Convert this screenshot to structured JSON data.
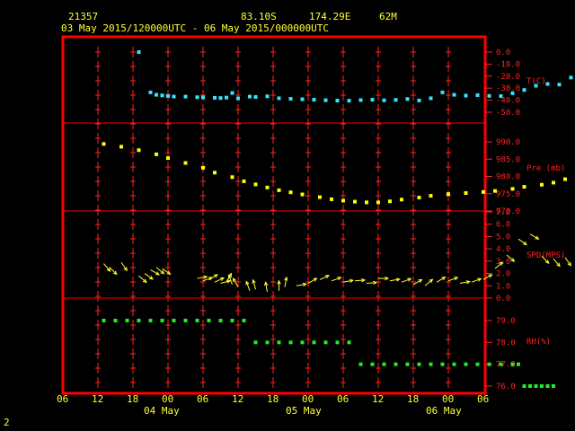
{
  "header": {
    "station": "21357",
    "latitude": "83.10S",
    "longitude": "174.29E",
    "elevation": "62M",
    "period": "03 May 2015/120000UTC - 06 May 2015/000000UTC"
  },
  "corner_label": "2",
  "colors": {
    "frame": "#ff0000",
    "text": "#ffff33",
    "temperature": "#33e6ff",
    "pressure": "#ffff00",
    "wind": "#ffff33",
    "humidity": "#22ee22"
  },
  "chart_data": {
    "type": "scatter",
    "x_unit": "hours since 03 May 2015 06 UTC",
    "x_ticks": [
      "06",
      "12",
      "18",
      "00",
      "06",
      "12",
      "18",
      "00",
      "06",
      "12",
      "18",
      "00",
      "06"
    ],
    "date_labels": [
      "04 May",
      "05 May",
      "06 May"
    ],
    "panels": [
      {
        "name": "T(C)",
        "ylim": [
          -50,
          0
        ],
        "ticks": [
          "0.0",
          "-10.0",
          "-20.0",
          "-30.0",
          "-40.0",
          "-50.0"
        ],
        "points": [
          [
            0,
            0
          ],
          [
            30,
            -31
          ],
          [
            31,
            -33
          ],
          [
            32,
            -34.5
          ],
          [
            33,
            -35.5
          ],
          [
            34,
            -36
          ],
          [
            36,
            -36.5
          ],
          [
            38,
            -37
          ],
          [
            40,
            -37.2
          ],
          [
            42,
            -37
          ],
          [
            44,
            -34.5
          ],
          [
            45,
            -38
          ],
          [
            46,
            -36
          ],
          [
            48,
            -36.5
          ],
          [
            50,
            -36
          ],
          [
            52,
            -36.3
          ],
          [
            54,
            -37.6
          ],
          [
            56,
            -37
          ],
          [
            58,
            -38.5
          ],
          [
            60,
            -39
          ],
          [
            62,
            -39.5
          ],
          [
            64,
            -39.4
          ],
          [
            66,
            -39.8
          ],
          [
            68,
            -39
          ],
          [
            70,
            -39.5
          ],
          [
            72,
            -39
          ],
          [
            74,
            -38.2
          ],
          [
            76,
            -40
          ],
          [
            78,
            -38
          ],
          [
            79,
            -36
          ],
          [
            80,
            -33.5
          ],
          [
            82,
            -34
          ],
          [
            84,
            -34.5
          ],
          [
            86,
            -34.3
          ],
          [
            88,
            -35
          ],
          [
            89,
            -37
          ],
          [
            90,
            -35
          ],
          [
            92,
            -33
          ],
          [
            94,
            -30
          ],
          [
            96,
            -26
          ],
          [
            98,
            -27
          ],
          [
            100,
            -21
          ]
        ],
        "point_hours": [
          13,
          15,
          16,
          17,
          18,
          19,
          21,
          23,
          24,
          26,
          27,
          28,
          29,
          30,
          32,
          33,
          35,
          37,
          39,
          41,
          43,
          45,
          47,
          49,
          51,
          53,
          55,
          57,
          59,
          61,
          63,
          65,
          67,
          69,
          71,
          73,
          75,
          77,
          79,
          81,
          83,
          85,
          87
        ],
        "values": [
          0,
          -33.5,
          -35.5,
          -36,
          -36.5,
          -37,
          -37,
          -37.5,
          -37.7,
          -38,
          -38.2,
          -37.8,
          -34,
          -38.5,
          -37,
          -37.3,
          -36.8,
          -38.4,
          -38.8,
          -39.2,
          -39.6,
          -40,
          -40.3,
          -40.4,
          -39.9,
          -39.6,
          -40.1,
          -39.7,
          -39,
          -40.2,
          -38.4,
          -33.5,
          -35.5,
          -36.2,
          -35.8,
          -36.4,
          -36.6,
          -34.2,
          -31.5,
          -28,
          -26.5,
          -27,
          -21.2
        ]
      },
      {
        "name": "Pre (mb)",
        "ylim": [
          970,
          990
        ],
        "ticks": [
          "990.0",
          "985.0",
          "980.0",
          "975.0",
          "970.0"
        ],
        "point_hours": [
          7,
          10,
          13,
          16,
          18,
          21,
          24,
          26,
          29,
          31,
          33,
          35,
          37,
          39,
          41,
          44,
          46,
          48,
          50,
          52,
          54,
          56,
          58,
          61,
          63,
          66,
          69,
          72,
          74,
          77,
          79,
          82,
          84,
          86,
          88
        ],
        "values": [
          989.4,
          988.6,
          987.6,
          986.4,
          985.3,
          983.9,
          982.5,
          981.1,
          979.8,
          978.6,
          977.7,
          976.8,
          976,
          975.4,
          974.8,
          974,
          973.4,
          973,
          972.7,
          972.5,
          972.5,
          972.8,
          973.3,
          973.9,
          974.4,
          974.9,
          975.2,
          975.5,
          975.8,
          976.4,
          977,
          977.6,
          978.2,
          979.2,
          980.4
        ]
      },
      {
        "name": "SPD(MPS)",
        "ylim": [
          0,
          7
        ],
        "ticks": [
          "7.0",
          "6.0",
          "5.0",
          "4.0",
          "3.0",
          "2.0",
          "1.0",
          "0.0"
        ],
        "point_hours": [
          7,
          8,
          10,
          13,
          14,
          15,
          16,
          17,
          23,
          24,
          25,
          26,
          27,
          28,
          29,
          30,
          32,
          33,
          35,
          37,
          38,
          40,
          42,
          44,
          46,
          48,
          50,
          52,
          54,
          56,
          58,
          60,
          62,
          64,
          66,
          68,
          70,
          72,
          74,
          76,
          78,
          80,
          82,
          84,
          86,
          88
        ],
        "values": [
          2.8,
          2.5,
          2.9,
          1.8,
          2,
          2.3,
          2.5,
          2.4,
          1.6,
          1.4,
          1.5,
          1.3,
          1.2,
          1.3,
          1.1,
          0.9,
          0.6,
          0.7,
          0.5,
          0.6,
          0.9,
          1,
          1.2,
          1.5,
          1.4,
          1.3,
          1.4,
          1.2,
          1.6,
          1.4,
          1.3,
          1.1,
          1.0,
          1.3,
          1.4,
          1.2,
          1.3,
          1.5,
          2.4,
          3.5,
          4.8,
          5.2,
          3.4,
          3.2,
          3.3,
          7.2
        ],
        "directions": [
          40,
          45,
          35,
          50,
          55,
          60,
          50,
          55,
          100,
          110,
          120,
          115,
          105,
          150,
          200,
          210,
          200,
          195,
          190,
          180,
          170,
          100,
          120,
          115,
          110,
          100,
          95,
          95,
          90,
          100,
          110,
          120,
          130,
          120,
          110,
          100,
          110,
          120,
          130,
          50,
          55,
          60,
          45,
          40,
          35,
          45
        ]
      },
      {
        "name": "RH(%)",
        "ylim": [
          76,
          79
        ],
        "ticks": [
          "79.0",
          "78.0",
          "77.0",
          "76.0"
        ],
        "point_hours": [
          7,
          9,
          11,
          13,
          15,
          17,
          19,
          21,
          23,
          25,
          27,
          29,
          31,
          33,
          35,
          37,
          39,
          41,
          43,
          45,
          47,
          49,
          51,
          53,
          55,
          57,
          59,
          61,
          63,
          65,
          67,
          69,
          71,
          73,
          75,
          77,
          78,
          79,
          80,
          81,
          82,
          83,
          84
        ],
        "values": [
          79,
          79,
          79,
          79,
          79,
          79,
          79,
          79,
          79,
          79,
          79,
          79,
          79,
          78,
          78,
          78,
          78,
          78,
          78,
          78,
          78,
          78,
          77,
          77,
          77,
          77,
          77,
          77,
          77,
          77,
          77,
          77,
          77,
          77,
          77,
          77,
          77,
          76,
          76,
          76,
          76,
          76,
          76
        ]
      }
    ]
  }
}
